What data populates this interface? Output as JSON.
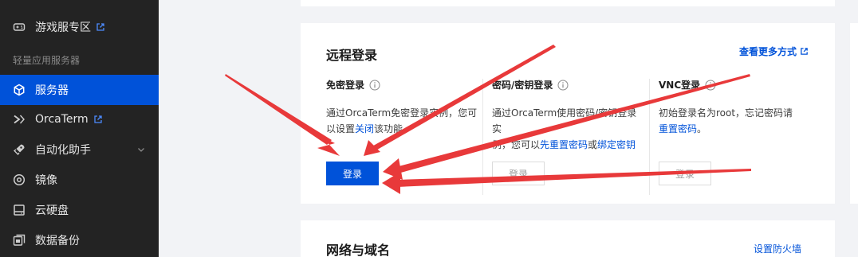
{
  "sidebar": {
    "section_label": "轻量应用服务器",
    "items": [
      {
        "label": "游戏服专区"
      },
      {
        "label": "服务器"
      },
      {
        "label": "OrcaTerm"
      },
      {
        "label": "自动化助手"
      },
      {
        "label": "镜像"
      },
      {
        "label": "云硬盘"
      },
      {
        "label": "数据备份"
      }
    ]
  },
  "remote": {
    "title": "远程登录",
    "more_link": "查看更多方式",
    "cols": [
      {
        "title": "免密登录",
        "desc_1": "通过OrcaTerm免密登录实例，您可",
        "desc_2a": "以设置",
        "desc_2_link": "关闭",
        "desc_2b": "该功能",
        "button": "登录"
      },
      {
        "title": "密码/密钥登录",
        "desc_1": "通过OrcaTerm使用密码/密钥登录实",
        "desc_2a": "例，您可以",
        "desc_2_link1": "先重置密码",
        "desc_2_mid": "或",
        "desc_2_link2": "绑定密钥",
        "button": "登录"
      },
      {
        "title": "VNC登录",
        "desc_1": "初始登录名为root，忘记密码请",
        "desc_2_link": "重置密码",
        "desc_2b": "。",
        "button": "登录"
      }
    ]
  },
  "network": {
    "title": "网络与域名",
    "link": "设置防火墙"
  },
  "colors": {
    "sidebar_bg": "#232323",
    "active": "#0052d9",
    "annotation_arrow": "#e8393a"
  }
}
